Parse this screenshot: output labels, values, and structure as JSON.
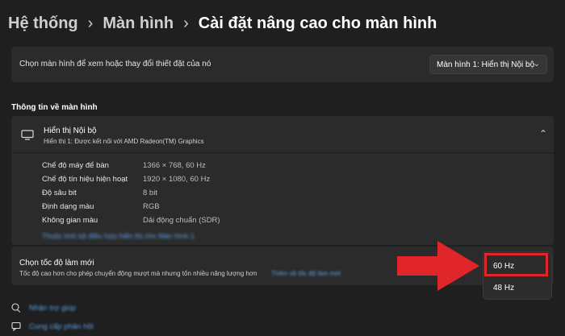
{
  "breadcrumb": {
    "items": [
      "Hệ thống",
      "Màn hình"
    ],
    "current": "Cài đặt nâng cao cho màn hình",
    "separator": "›"
  },
  "display_select": {
    "label": "Chọn màn hình để xem hoặc thay đổi thiết đặt của nó",
    "value": "Màn hình 1: Hiển thị Nội bộ"
  },
  "display_info": {
    "section_title": "Thông tin về màn hình",
    "title": "Hiển thị Nội bộ",
    "subtitle": "Hiển thị 1: Được kết nối với AMD Radeon(TM) Graphics",
    "properties": [
      {
        "label": "Chế độ máy để bàn",
        "value": "1366 × 768, 60 Hz"
      },
      {
        "label": "Chế độ tín hiệu hiện hoạt",
        "value": "1920 × 1080, 60 Hz"
      },
      {
        "label": "Độ sâu bit",
        "value": "8 bit"
      },
      {
        "label": "Định dạng màu",
        "value": "RGB"
      },
      {
        "label": "Không gian màu",
        "value": "Dải động chuẩn (SDR)"
      }
    ],
    "link": "Thuộc tính bộ điều hợp hiển thị cho Màn hình 1"
  },
  "refresh_rate": {
    "title": "Chọn tốc độ làm mới",
    "description": "Tốc độ cao hơn cho phép chuyển động mượt mà nhưng tốn nhiều năng lượng hơn",
    "link": "Thêm về tốc độ làm mới",
    "options": [
      "60 Hz",
      "48 Hz"
    ],
    "selected": "60 Hz"
  },
  "footer": {
    "help": "Nhận trợ giúp",
    "feedback": "Cung cấp phản hồi"
  },
  "icons": {
    "monitor": "monitor-icon",
    "chevron_up": "chevron-up-icon",
    "chevron_down": "chevron-down-icon",
    "help": "help-icon",
    "feedback": "feedback-icon"
  },
  "colors": {
    "background": "#1f1f1f",
    "card": "#2b2b2b",
    "link": "#5aa0e6",
    "annotation_red": "#e0262a"
  }
}
